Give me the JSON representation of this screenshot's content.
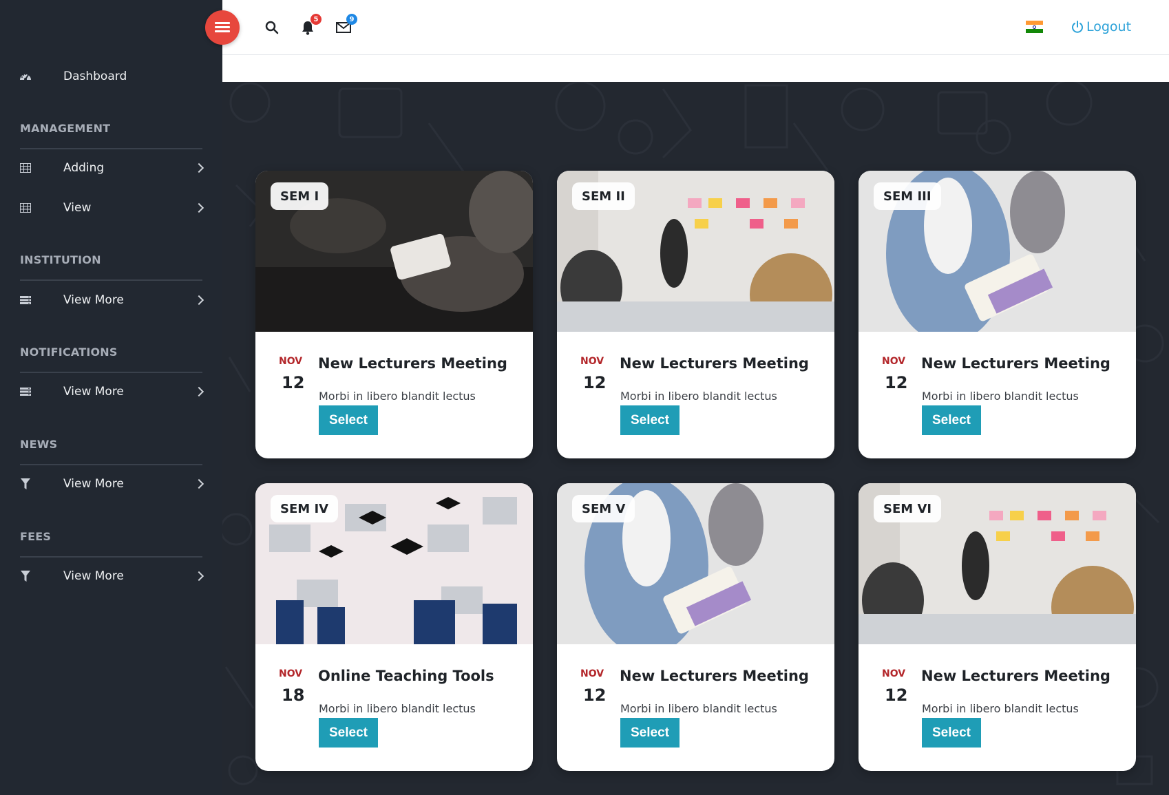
{
  "header": {
    "notifications_count": "5",
    "messages_count": "9",
    "logout_label": "Logout"
  },
  "sidebar": {
    "dashboard": {
      "label": "Dashboard",
      "icon": "dashboard-icon"
    },
    "sections": [
      {
        "title": "MANAGEMENT",
        "items": [
          {
            "label": "Adding",
            "icon": "table-icon"
          },
          {
            "label": "View",
            "icon": "table-icon"
          }
        ]
      },
      {
        "title": "INSTITUTION",
        "items": [
          {
            "label": "View More",
            "icon": "server-icon"
          }
        ]
      },
      {
        "title": "NOTIFICATIONS",
        "items": [
          {
            "label": "View More",
            "icon": "server-icon"
          }
        ]
      },
      {
        "title": "NEWS",
        "items": [
          {
            "label": "View More",
            "icon": "filter-icon"
          }
        ]
      },
      {
        "title": "FEES",
        "items": [
          {
            "label": "View More",
            "icon": "filter-icon"
          }
        ]
      }
    ]
  },
  "cards": [
    {
      "sem": "SEM I",
      "month": "NOV",
      "day": "12",
      "title": "New Lecturers Meeting",
      "desc": "Morbi in libero blandit lectus",
      "button": "Select"
    },
    {
      "sem": "SEM II",
      "month": "NOV",
      "day": "12",
      "title": "New Lecturers Meeting",
      "desc": "Morbi in libero blandit lectus",
      "button": "Select"
    },
    {
      "sem": "SEM III",
      "month": "NOV",
      "day": "12",
      "title": "New Lecturers Meeting",
      "desc": "Morbi in libero blandit lectus",
      "button": "Select"
    },
    {
      "sem": "SEM IV",
      "month": "NOV",
      "day": "18",
      "title": "Online Teaching Tools",
      "desc": "Morbi in libero blandit lectus",
      "button": "Select"
    },
    {
      "sem": "SEM V",
      "month": "NOV",
      "day": "12",
      "title": "New Lecturers Meeting",
      "desc": "Morbi in libero blandit lectus",
      "button": "Select"
    },
    {
      "sem": "SEM VI",
      "month": "NOV",
      "day": "12",
      "title": "New Lecturers Meeting",
      "desc": "Morbi in libero blandit lectus",
      "button": "Select"
    }
  ],
  "colors": {
    "sidebar_bg": "#222831",
    "menu_button": "#e7473d",
    "select_button": "#1f9db6",
    "month_text": "#b3262a",
    "logout_text": "#2aa1d8"
  }
}
